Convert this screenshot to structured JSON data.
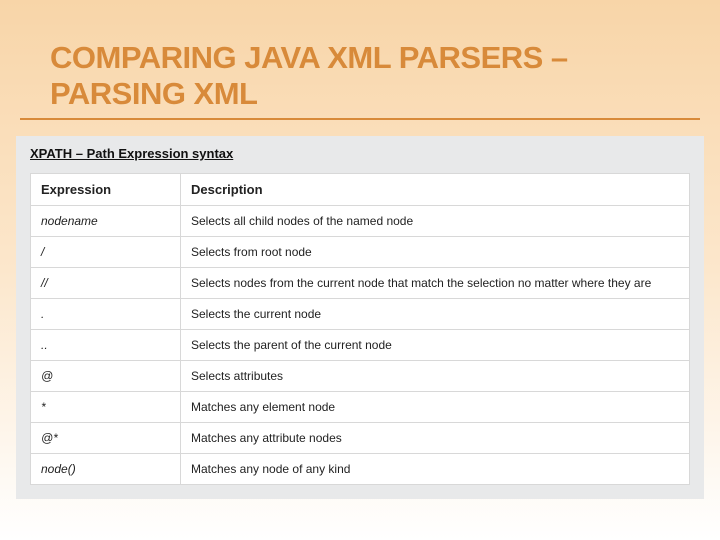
{
  "title": "COMPARING JAVA XML PARSERS – PARSING XML",
  "subtitle": "XPATH – Path Expression syntax",
  "headers": {
    "col0": "Expression",
    "col1": "Description"
  },
  "rows": [
    {
      "expr": "nodename",
      "desc": "Selects all child nodes of the named node"
    },
    {
      "expr": "/",
      "desc": "Selects from root node"
    },
    {
      "expr": "//",
      "desc": "Selects nodes from the current node that match the selection no matter where they are"
    },
    {
      "expr": ".",
      "desc": "Selects the current node"
    },
    {
      "expr": "..",
      "desc": "Selects the parent of the current node"
    },
    {
      "expr": "@",
      "desc": "Selects attributes"
    },
    {
      "expr": "*",
      "desc": "Matches any element node"
    },
    {
      "expr": "@*",
      "desc": "Matches any attribute nodes"
    },
    {
      "expr": "node()",
      "desc": "Matches any node of any kind"
    }
  ]
}
